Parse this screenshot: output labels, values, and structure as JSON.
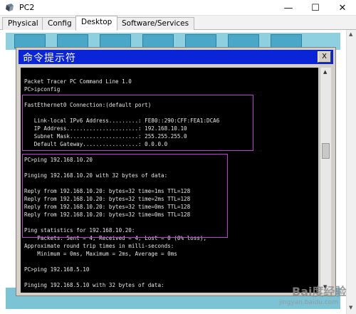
{
  "window": {
    "title": "PC2",
    "minimize": "—",
    "maximize": "☐",
    "close": "✕"
  },
  "tabs": [
    "Physical",
    "Config",
    "Desktop",
    "Software/Services"
  ],
  "active_tab": "Desktop",
  "command_prompt": {
    "title": "命令提示符",
    "close": "X",
    "lines": [
      "Packet Tracer PC Command Line 1.0",
      "PC>ipconfig",
      "",
      "FastEthernet0 Connection:(default port)",
      "",
      "   Link-local IPv6 Address.........: FE80::290:CFF:FEA1:DCA6",
      "   IP Address......................: 192.168.10.10",
      "   Subnet Mask.....................: 255.255.255.0",
      "   Default Gateway.................: 0.0.0.0",
      "",
      "PC>ping 192.168.10.20",
      "",
      "Pinging 192.168.10.20 with 32 bytes of data:",
      "",
      "Reply from 192.168.10.20: bytes=32 time=1ms TTL=128",
      "Reply from 192.168.10.20: bytes=32 time=2ms TTL=128",
      "Reply from 192.168.10.20: bytes=32 time=0ms TTL=128",
      "Reply from 192.168.10.20: bytes=32 time=0ms TTL=128",
      "",
      "Ping statistics for 192.168.10.20:",
      "    Packets: Sent = 4, Received = 4, Lost = 0 (0% loss),",
      "Approximate round trip times in milli-seconds:",
      "    Minimum = 0ms, Maximum = 2ms, Average = 0ms",
      "",
      "PC>ping 192.168.5.10",
      "",
      "Pinging 192.168.5.10 with 32 bytes of data:"
    ]
  },
  "watermark": {
    "brand": "Bai度经验",
    "url": "jingyan.baidu.com"
  },
  "colors": {
    "cmd_title_bg": "#0a24d8",
    "console_bg": "#000000",
    "console_text": "#e6e6e6",
    "highlight": "#c23bd6"
  }
}
